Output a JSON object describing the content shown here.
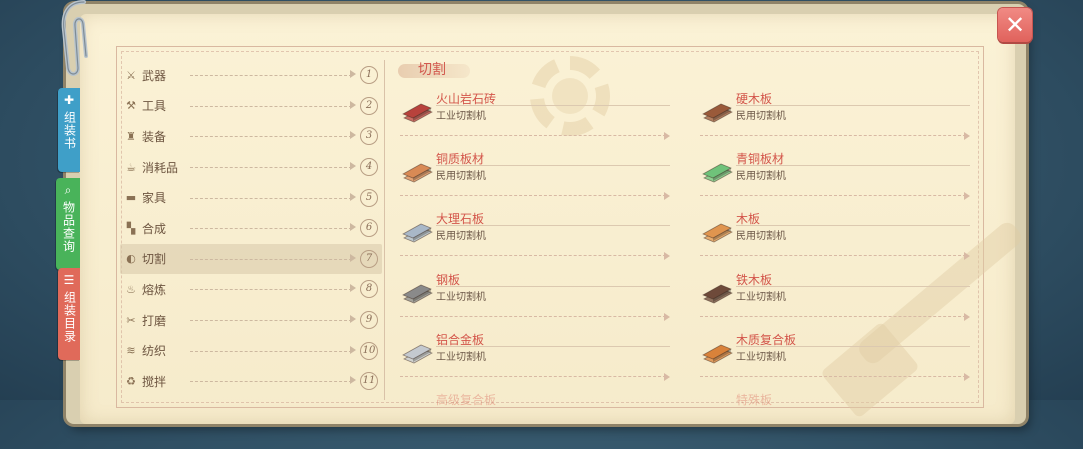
{
  "close": {
    "label": "✕"
  },
  "side_tabs": [
    {
      "label": "组装书",
      "icon": "wrench-icon",
      "glyph": "✚",
      "color": "#3f9fc8"
    },
    {
      "label": "物品查询",
      "icon": "magnifier-icon",
      "glyph": "⌕",
      "color": "#49b35a"
    },
    {
      "label": "组装目录",
      "icon": "list-icon",
      "glyph": "☰",
      "color": "#e06a5a"
    }
  ],
  "menu": [
    {
      "label": "武器",
      "icon": "sword-icon",
      "glyph": "⚔",
      "num": "1"
    },
    {
      "label": "工具",
      "icon": "hammer-icon",
      "glyph": "⚒",
      "num": "2"
    },
    {
      "label": "装备",
      "icon": "armor-icon",
      "glyph": "♜",
      "num": "3"
    },
    {
      "label": "消耗品",
      "icon": "food-icon",
      "glyph": "☕",
      "num": "4"
    },
    {
      "label": "家具",
      "icon": "furniture-icon",
      "glyph": "▬",
      "num": "5"
    },
    {
      "label": "合成",
      "icon": "blocks-icon",
      "glyph": "▚",
      "num": "6"
    },
    {
      "label": "切割",
      "icon": "saw-icon",
      "glyph": "◐",
      "num": "7",
      "active": true
    },
    {
      "label": "熔炼",
      "icon": "fire-icon",
      "glyph": "♨",
      "num": "8"
    },
    {
      "label": "打磨",
      "icon": "grind-icon",
      "glyph": "✂",
      "num": "9"
    },
    {
      "label": "纺织",
      "icon": "weave-icon",
      "glyph": "≋",
      "num": "10"
    },
    {
      "label": "搅拌",
      "icon": "mixer-icon",
      "glyph": "♻",
      "num": "11"
    }
  ],
  "section_title": "切割",
  "recipes_left": [
    {
      "name": "火山岩石砖",
      "machine": "工业切割机",
      "color": "#b8423c",
      "icon": "lava-brick-icon"
    },
    {
      "name": "铜质板材",
      "machine": "民用切割机",
      "color": "#d98a55",
      "icon": "copper-plate-icon"
    },
    {
      "name": "大理石板",
      "machine": "民用切割机",
      "color": "#a9b8c8",
      "icon": "marble-slab-icon"
    },
    {
      "name": "钢板",
      "machine": "工业切割机",
      "color": "#8a8a8a",
      "icon": "steel-plate-icon"
    },
    {
      "name": "铝合金板",
      "machine": "工业切割机",
      "color": "#c4c9cf",
      "icon": "aluminum-plate-icon"
    },
    {
      "name": "高级复合板",
      "machine": "",
      "color": "#d8c6b0",
      "icon": "composite-plate-icon"
    }
  ],
  "recipes_right": [
    {
      "name": "硬木板",
      "machine": "民用切割机",
      "color": "#9a5a3a",
      "icon": "hardwood-plank-icon"
    },
    {
      "name": "青铜板材",
      "machine": "民用切割机",
      "color": "#6fc27a",
      "icon": "bronze-plate-icon"
    },
    {
      "name": "木板",
      "machine": "民用切割机",
      "color": "#e0954f",
      "icon": "wood-plank-icon"
    },
    {
      "name": "铁木板",
      "machine": "工业切割机",
      "color": "#6e4a3a",
      "icon": "ironwood-plank-icon"
    },
    {
      "name": "木质复合板",
      "machine": "工业切割机",
      "color": "#d9823a",
      "icon": "wood-composite-icon"
    },
    {
      "name": "特殊板",
      "machine": "",
      "color": "#d8c6b0",
      "icon": "special-plate-icon"
    }
  ]
}
